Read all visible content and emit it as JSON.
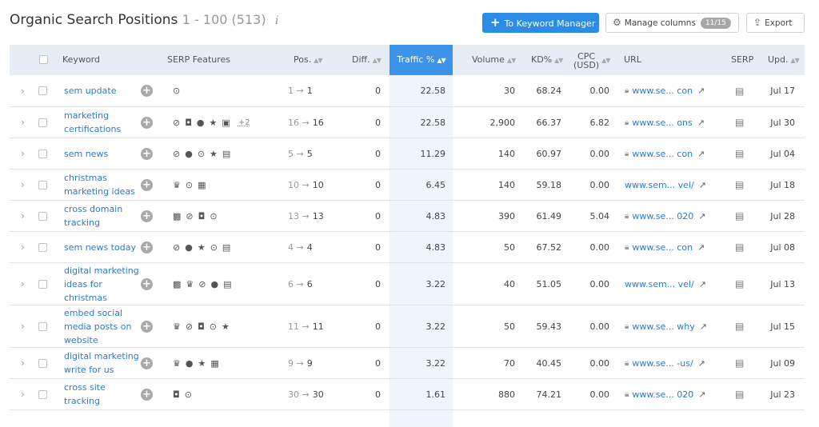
{
  "header": {
    "title": "Organic Search Positions",
    "range": "1 - 100 (513)",
    "info_icon": "i",
    "keyword_manager_label": "To Keyword Manager",
    "manage_columns_label": "Manage columns",
    "manage_columns_badge": "11/15",
    "export_label": "Export"
  },
  "columns": {
    "keyword": "Keyword",
    "serp_features": "SERP Features",
    "pos": "Pos.",
    "diff": "Diff.",
    "traffic": "Traffic %",
    "volume": "Volume",
    "kd": "KD%",
    "cpc_line1": "CPC",
    "cpc_line2": "(USD)",
    "url": "URL",
    "serp": "SERP",
    "upd": "Upd."
  },
  "colors": {
    "primary": "#2b8ce8",
    "link": "#2b7bd3",
    "header_bg": "#e6edf4",
    "traffic_highlight": "#eef5fd"
  },
  "rows": [
    {
      "keyword": "sem update",
      "features": [
        "play-icon"
      ],
      "more": "",
      "pos_prev": "1",
      "pos": "1",
      "diff": "0",
      "traffic": "22.58",
      "volume": "30",
      "kd": "68.24",
      "cpc": "0.00",
      "secure": true,
      "url": "www.se... con",
      "upd": "Jul 17"
    },
    {
      "keyword": "marketing certifications",
      "features": [
        "link-icon",
        "review-icon",
        "faq-icon",
        "star-icon",
        "image-pack-icon"
      ],
      "more": "+2",
      "pos_prev": "16",
      "pos": "16",
      "diff": "0",
      "traffic": "22.58",
      "volume": "2,900",
      "kd": "66.37",
      "cpc": "6.82",
      "secure": true,
      "url": "www.se... ons",
      "upd": "Jul 30"
    },
    {
      "keyword": "sem news",
      "features": [
        "link-icon",
        "faq-icon",
        "play-icon",
        "star-icon",
        "news-icon"
      ],
      "more": "",
      "pos_prev": "5",
      "pos": "5",
      "diff": "0",
      "traffic": "11.29",
      "volume": "140",
      "kd": "60.97",
      "cpc": "0.00",
      "secure": true,
      "url": "www.se... con",
      "upd": "Jul 04"
    },
    {
      "keyword": "christmas marketing ideas",
      "features": [
        "crown-icon",
        "play-icon",
        "news-box-icon"
      ],
      "more": "",
      "pos_prev": "10",
      "pos": "10",
      "diff": "0",
      "traffic": "6.45",
      "volume": "140",
      "kd": "59.18",
      "cpc": "0.00",
      "secure": false,
      "url": "www.sem... vel/",
      "upd": "Jul 18"
    },
    {
      "keyword": "cross domain tracking",
      "features": [
        "image-icon",
        "link-icon",
        "review-icon",
        "play-icon"
      ],
      "more": "",
      "pos_prev": "13",
      "pos": "13",
      "diff": "0",
      "traffic": "4.83",
      "volume": "390",
      "kd": "61.49",
      "cpc": "5.04",
      "secure": true,
      "url": "www.se... 020",
      "upd": "Jul 28"
    },
    {
      "keyword": "sem news today",
      "features": [
        "link-icon",
        "faq-icon",
        "star-icon",
        "play-icon",
        "news-icon"
      ],
      "more": "",
      "pos_prev": "4",
      "pos": "4",
      "diff": "0",
      "traffic": "4.83",
      "volume": "50",
      "kd": "67.52",
      "cpc": "0.00",
      "secure": true,
      "url": "www.se... con",
      "upd": "Jul 08"
    },
    {
      "keyword": "digital marketing ideas for christmas",
      "features": [
        "image-icon",
        "crown-icon",
        "link-icon",
        "faq-icon",
        "news-icon"
      ],
      "more": "",
      "pos_prev": "6",
      "pos": "6",
      "diff": "0",
      "traffic": "3.22",
      "volume": "40",
      "kd": "51.05",
      "cpc": "0.00",
      "secure": false,
      "url": "www.sem... vel/",
      "upd": "Jul 13"
    },
    {
      "keyword": "embed social media posts on website",
      "features": [
        "crown-icon",
        "link-icon",
        "review-icon",
        "play-icon",
        "star-icon"
      ],
      "more": "",
      "pos_prev": "11",
      "pos": "11",
      "diff": "0",
      "traffic": "3.22",
      "volume": "50",
      "kd": "59.43",
      "cpc": "0.00",
      "secure": true,
      "url": "www.se... why",
      "upd": "Jul 15"
    },
    {
      "keyword": "digital marketing write for us",
      "features": [
        "crown-icon",
        "faq-icon",
        "star-icon",
        "news-box-icon"
      ],
      "more": "",
      "pos_prev": "9",
      "pos": "9",
      "diff": "0",
      "traffic": "3.22",
      "volume": "70",
      "kd": "40.45",
      "cpc": "0.00",
      "secure": true,
      "url": "www.se... -us/",
      "upd": "Jul 09"
    },
    {
      "keyword": "cross site tracking",
      "features": [
        "review-icon",
        "play-icon"
      ],
      "more": "",
      "pos_prev": "30",
      "pos": "30",
      "diff": "0",
      "traffic": "1.61",
      "volume": "880",
      "kd": "74.21",
      "cpc": "0.00",
      "secure": true,
      "url": "www.se... 020",
      "upd": "Jul 23"
    }
  ]
}
